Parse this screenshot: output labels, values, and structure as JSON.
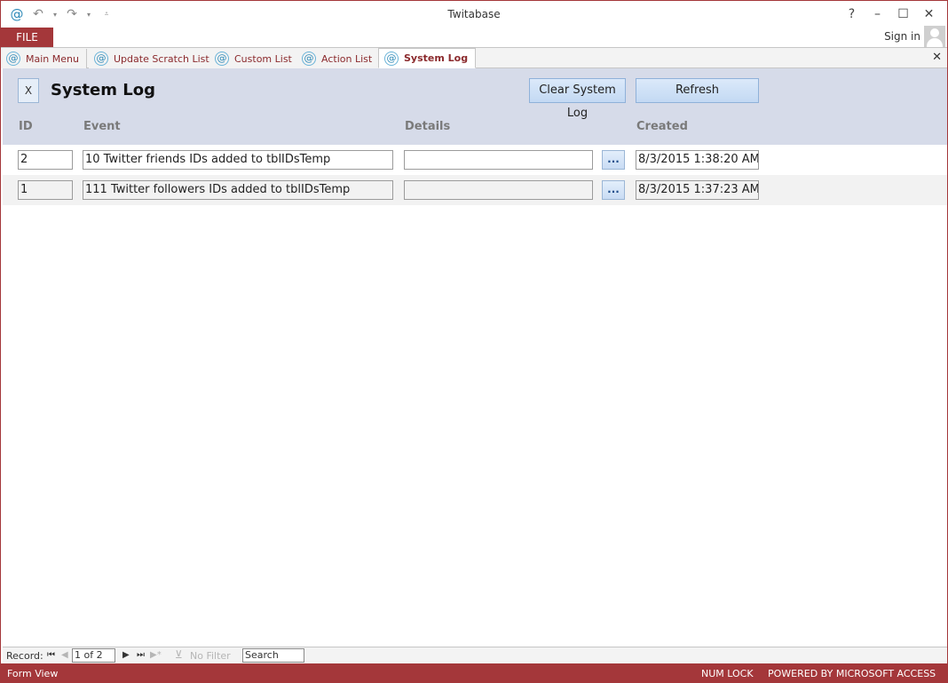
{
  "app": {
    "title": "Twitabase"
  },
  "quick_access": {
    "app_icon": "at-icon",
    "undo_icon": "undo-icon",
    "redo_icon": "redo-icon",
    "customize_icon": "customize-qat-icon"
  },
  "window_controls": {
    "help": "?",
    "minimize": "–",
    "maximize": "☐",
    "close": "✕"
  },
  "ribbon": {
    "file_label": "FILE",
    "sign_in": "Sign in"
  },
  "doc_tabs": [
    {
      "label": "Main Menu"
    },
    {
      "label": "Update Scratch List"
    },
    {
      "label": "Custom List"
    },
    {
      "label": "Action List"
    },
    {
      "label": "System Log",
      "active": true
    }
  ],
  "doc_tabs_close": "✕",
  "form": {
    "close_button": "X",
    "title": "System Log",
    "clear_button": "Clear System Log",
    "refresh_button": "Refresh",
    "columns": {
      "id": "ID",
      "event": "Event",
      "details": "Details",
      "created": "Created"
    },
    "details_button": "...",
    "rows": [
      {
        "id": "2",
        "event": "10 Twitter friends IDs added to tblIDsTemp",
        "details": "",
        "created": "8/3/2015 1:38:20 AM"
      },
      {
        "id": "1",
        "event": "111 Twitter followers IDs added to tblIDsTemp",
        "details": "",
        "created": "8/3/2015 1:37:23 AM"
      }
    ]
  },
  "record_nav": {
    "label": "Record:",
    "first": "⏮",
    "prev": "◀",
    "position": "1 of 2",
    "next": "▶",
    "last": "⏭",
    "new": "▶*",
    "filter_icon": "filter-icon",
    "filter": "No Filter",
    "search_placeholder": "Search"
  },
  "status": {
    "view": "Form View",
    "num_lock": "NUM LOCK",
    "powered_by": "POWERED BY MICROSOFT ACCESS"
  },
  "colors": {
    "accent": "#a4373a",
    "header_bg": "#d6dbe9",
    "button_bg": "#c3d9f3"
  }
}
